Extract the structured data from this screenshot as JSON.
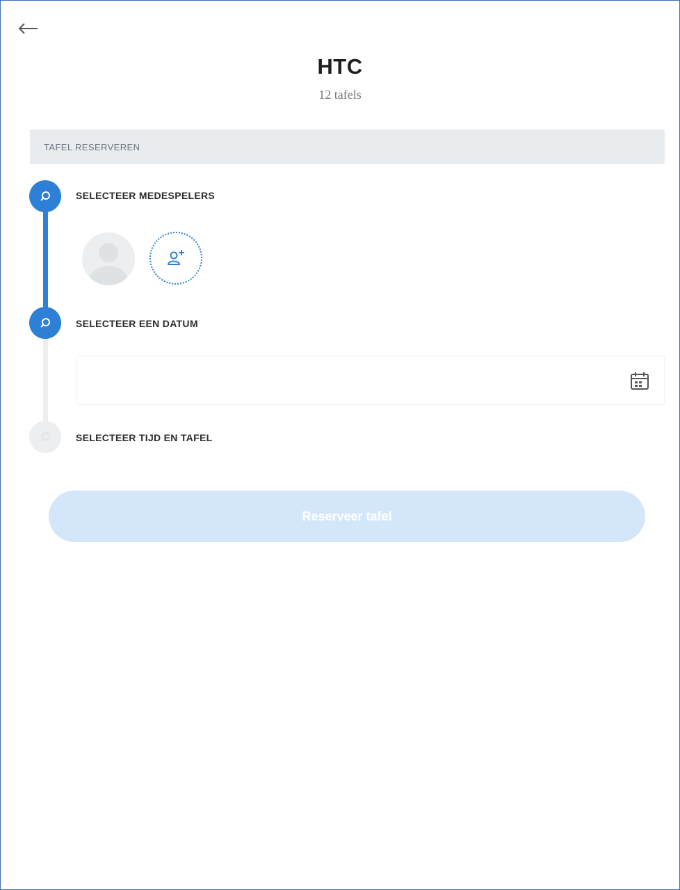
{
  "header": {
    "title": "HTC",
    "subtitle": "12 tafels"
  },
  "section": {
    "label": "TAFEL RESERVEREN"
  },
  "steps": [
    {
      "label": "SELECTEER MEDESPELERS",
      "state": "active"
    },
    {
      "label": "SELECTEER EEN DATUM",
      "state": "active"
    },
    {
      "label": "SELECTEER TIJD EN TAFEL",
      "state": "inactive"
    }
  ],
  "date_input": {
    "value": "",
    "placeholder": ""
  },
  "actions": {
    "reserve_label": "Reserveer tafel"
  },
  "colors": {
    "accent": "#2e7fd6",
    "inactive": "#eceef0",
    "button_disabled": "#d4e7fa"
  },
  "icons": {
    "back": "arrow-left-icon",
    "step": "search-icon",
    "add_player": "add-user-icon",
    "calendar": "calendar-icon"
  }
}
